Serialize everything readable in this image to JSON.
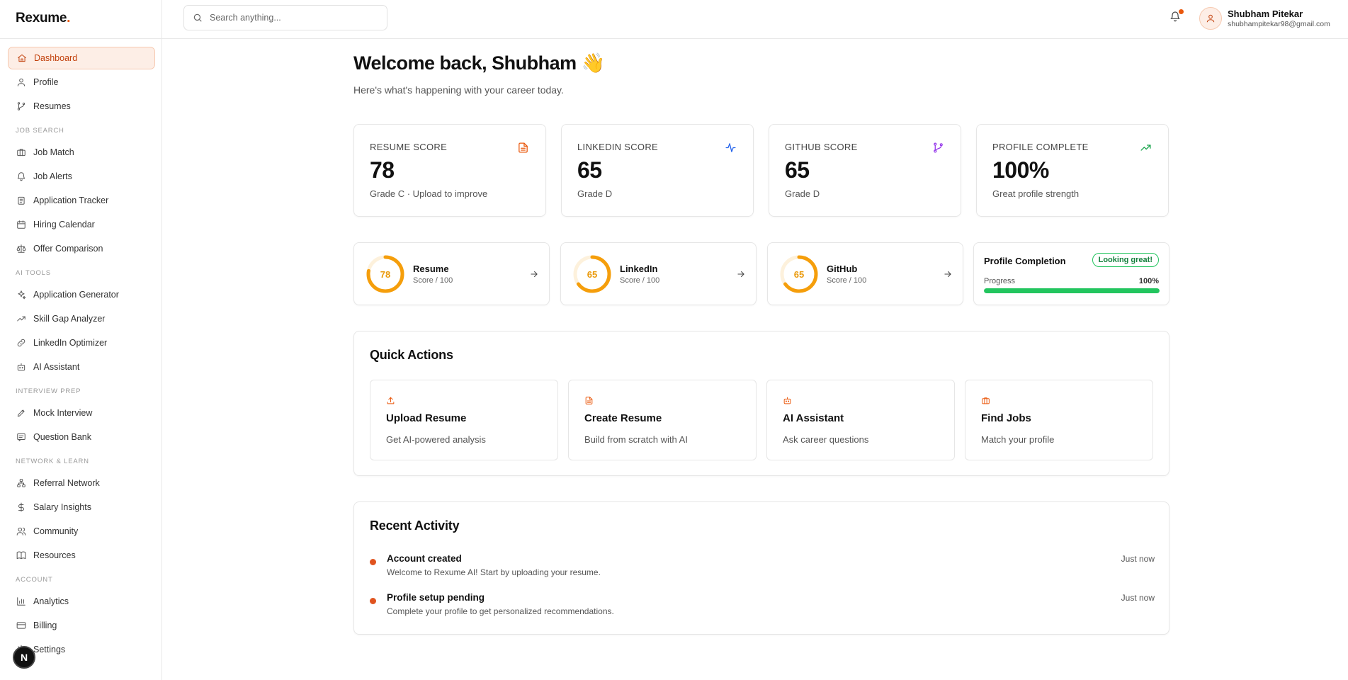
{
  "brand": {
    "name": "Rexume",
    "dot": "."
  },
  "sidebar": {
    "top_items": [
      {
        "label": "Dashboard",
        "icon": "home-icon",
        "active": true
      },
      {
        "label": "Profile",
        "icon": "user-icon"
      },
      {
        "label": "Resumes",
        "icon": "git-branch-icon"
      }
    ],
    "sections": [
      {
        "label": "JOB SEARCH",
        "items": [
          {
            "label": "Job Match",
            "icon": "briefcase-icon"
          },
          {
            "label": "Job Alerts",
            "icon": "bell-icon"
          },
          {
            "label": "Application Tracker",
            "icon": "clipboard-icon"
          },
          {
            "label": "Hiring Calendar",
            "icon": "calendar-icon"
          },
          {
            "label": "Offer Comparison",
            "icon": "scale-icon"
          }
        ]
      },
      {
        "label": "AI TOOLS",
        "items": [
          {
            "label": "Application Generator",
            "icon": "sparkles-icon"
          },
          {
            "label": "Skill Gap Analyzer",
            "icon": "trending-up-icon"
          },
          {
            "label": "LinkedIn Optimizer",
            "icon": "link-icon"
          },
          {
            "label": "AI Assistant",
            "icon": "bot-icon"
          }
        ]
      },
      {
        "label": "INTERVIEW PREP",
        "items": [
          {
            "label": "Mock Interview",
            "icon": "pen-icon"
          },
          {
            "label": "Question Bank",
            "icon": "message-square-icon"
          }
        ]
      },
      {
        "label": "NETWORK & LEARN",
        "items": [
          {
            "label": "Referral Network",
            "icon": "network-icon"
          },
          {
            "label": "Salary Insights",
            "icon": "dollar-icon"
          },
          {
            "label": "Community",
            "icon": "users-icon"
          },
          {
            "label": "Resources",
            "icon": "book-icon"
          }
        ]
      },
      {
        "label": "ACCOUNT",
        "items": [
          {
            "label": "Analytics",
            "icon": "bar-chart-icon"
          },
          {
            "label": "Billing",
            "icon": "credit-card-icon"
          },
          {
            "label": "Settings",
            "icon": "settings-icon"
          }
        ]
      }
    ],
    "next_badge": "N"
  },
  "header": {
    "search_placeholder": "Search anything...",
    "user_name": "Shubham Pitekar",
    "user_email": "shubhampitekar98@gmail.com"
  },
  "main": {
    "welcome": "Welcome back, Shubham 👋",
    "subtitle": "Here's what's happening with your career today.",
    "stats": [
      {
        "label": "RESUME SCORE",
        "value": "78",
        "note": "Grade C · Upload to improve",
        "icon": "file-text-icon",
        "color": "#ea580c"
      },
      {
        "label": "LINKEDIN SCORE",
        "value": "65",
        "note": "Grade D",
        "icon": "activity-icon",
        "color": "#2563eb"
      },
      {
        "label": "GITHUB SCORE",
        "value": "65",
        "note": "Grade D",
        "icon": "git-branch-icon",
        "color": "#9333ea"
      },
      {
        "label": "PROFILE COMPLETE",
        "value": "100%",
        "note": "Great profile strength",
        "icon": "trending-up-icon",
        "color": "#16a34a"
      }
    ],
    "scores": [
      {
        "name": "Resume",
        "value": 78,
        "sub": "Score / 100"
      },
      {
        "name": "LinkedIn",
        "value": 65,
        "sub": "Score / 100"
      },
      {
        "name": "GitHub",
        "value": 65,
        "sub": "Score / 100"
      }
    ],
    "ring_color": "#f59e0b",
    "profile_completion": {
      "title": "Profile Completion",
      "badge": "Looking great!",
      "progress_label": "Progress",
      "progress_value": "100%",
      "progress_fraction": 1.0
    },
    "quick_actions": {
      "title": "Quick Actions",
      "items": [
        {
          "title": "Upload Resume",
          "desc": "Get AI-powered analysis",
          "icon": "upload-icon"
        },
        {
          "title": "Create Resume",
          "desc": "Build from scratch with AI",
          "icon": "file-text-icon"
        },
        {
          "title": "AI Assistant",
          "desc": "Ask career questions",
          "icon": "bot-icon"
        },
        {
          "title": "Find Jobs",
          "desc": "Match your profile",
          "icon": "briefcase-icon"
        }
      ]
    },
    "recent_activity": {
      "title": "Recent Activity",
      "items": [
        {
          "title": "Account created",
          "desc": "Welcome to Rexume AI! Start by uploading your resume.",
          "time": "Just now"
        },
        {
          "title": "Profile setup pending",
          "desc": "Complete your profile to get personalized recommendations.",
          "time": "Just now"
        }
      ]
    }
  }
}
